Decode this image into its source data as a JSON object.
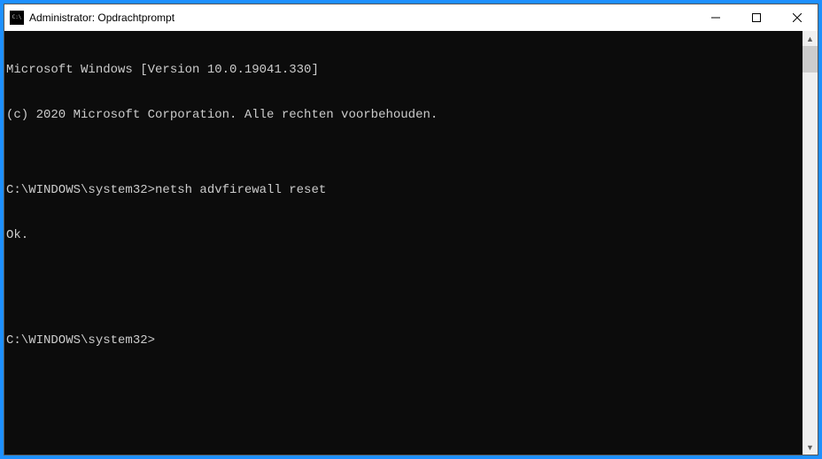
{
  "window": {
    "title": "Administrator: Opdrachtprompt"
  },
  "terminal": {
    "lines": [
      "Microsoft Windows [Version 10.0.19041.330]",
      "(c) 2020 Microsoft Corporation. Alle rechten voorbehouden.",
      "",
      "C:\\WINDOWS\\system32>netsh advfirewall reset",
      "Ok.",
      "",
      "",
      "C:\\WINDOWS\\system32>"
    ]
  }
}
